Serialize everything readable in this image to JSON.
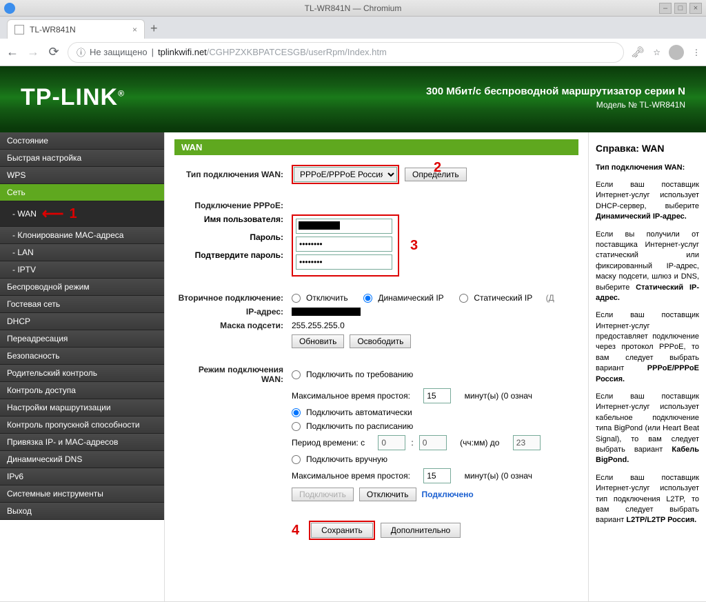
{
  "window": {
    "title": "TL-WR841N — Chromium"
  },
  "tab": {
    "title": "TL-WR841N"
  },
  "browser": {
    "insecure_label": "Не защищено",
    "url_host": "tplinkwifi.net",
    "url_path": "/CGHPZXKBPATCESGB/userRpm/Index.htm"
  },
  "banner": {
    "brand": "TP-LINK",
    "line1": "300 Мбит/с беспроводной маршрутизатор серии N",
    "line2": "Модель № TL-WR841N"
  },
  "sidebar": {
    "items": [
      "Состояние",
      "Быстрая настройка",
      "WPS",
      "Сеть",
      "- WAN",
      "- Клонирование MAC-адреса",
      "- LAN",
      "- IPTV",
      "Беспроводной режим",
      "Гостевая сеть",
      "DHCP",
      "Переадресация",
      "Безопасность",
      "Родительский контроль",
      "Контроль доступа",
      "Настройки маршрутизации",
      "Контроль пропускной способности",
      "Привязка IP- и MAC-адресов",
      "Динамический DNS",
      "IPv6",
      "Системные инструменты",
      "Выход"
    ]
  },
  "markers": {
    "m1": "1",
    "m2": "2",
    "m3": "3",
    "m4": "4"
  },
  "wan": {
    "header": "WAN",
    "conn_type_label": "Тип подключения WAN:",
    "conn_type_value": "PPPoE/PPPoE Россия",
    "detect_btn": "Определить",
    "pppoe_label": "Подключение PPPoE:",
    "username_label": "Имя пользователя:",
    "password_label": "Пароль:",
    "confirm_label": "Подтвердите пароль:",
    "password_value": "••••••••",
    "confirm_value": "••••••••",
    "secondary_label": "Вторичное подключение:",
    "radio_disable": "Отключить",
    "radio_dynip": "Динамический IP",
    "radio_static": "Статический IP",
    "parend": "(Д",
    "ip_label": "IP-адрес:",
    "mask_label": "Маска подсети:",
    "mask_value": "255.255.255.0",
    "refresh_btn": "Обновить",
    "release_btn": "Освободить",
    "mode_label": "Режим подключения WAN:",
    "mode_demand": "Подключить по требованию",
    "idle_label": "Максимальное время простоя:",
    "idle_value": "15",
    "idle_unit": "минут(ы) (0 означ",
    "mode_auto": "Подключить автоматически",
    "mode_sched": "Подключить по расписанию",
    "period_label": "Период времени: с",
    "period_colon": ":",
    "period_from_h": "0",
    "period_from_m": "0",
    "period_to_label": "(чч:мм) до",
    "period_to": "23",
    "mode_manual": "Подключить вручную",
    "idle2_value": "15",
    "connect_btn": "Подключить",
    "disconnect_btn": "Отключить",
    "status": "Подключено",
    "save_btn": "Сохранить",
    "advanced_btn": "Дополнительно"
  },
  "help": {
    "title": "Справка: WAN",
    "p1a": "Тип подключения WAN:",
    "p2": "Если ваш поставщик Интернет-услуг использует DHCP-сервер, выберите ",
    "p2b": "Динамический IP-адрес.",
    "p3": "Если вы получили от поставщика Интернет-услуг статический или фиксированный IP-адрес, маску подсети, шлюз и DNS, выберите ",
    "p3b": "Статический IP-адрес.",
    "p4": "Если ваш поставщик Интернет-услуг предоставляет подключение через протокол PPPoE, то вам следует выбрать вариант ",
    "p4b": "PPPoE/PPPoE Россия.",
    "p5": "Если ваш поставщик Интернет-услуг использует кабельное подключение типа BigPond (или Heart Beat Signal), то вам следует выбрать вариант ",
    "p5b": "Кабель BigPond.",
    "p6": "Если ваш поставщик Интернет-услуг использует тип подключения L2TP, то вам следует выбрать вариант ",
    "p6b": "L2TP/L2TP Россия."
  }
}
